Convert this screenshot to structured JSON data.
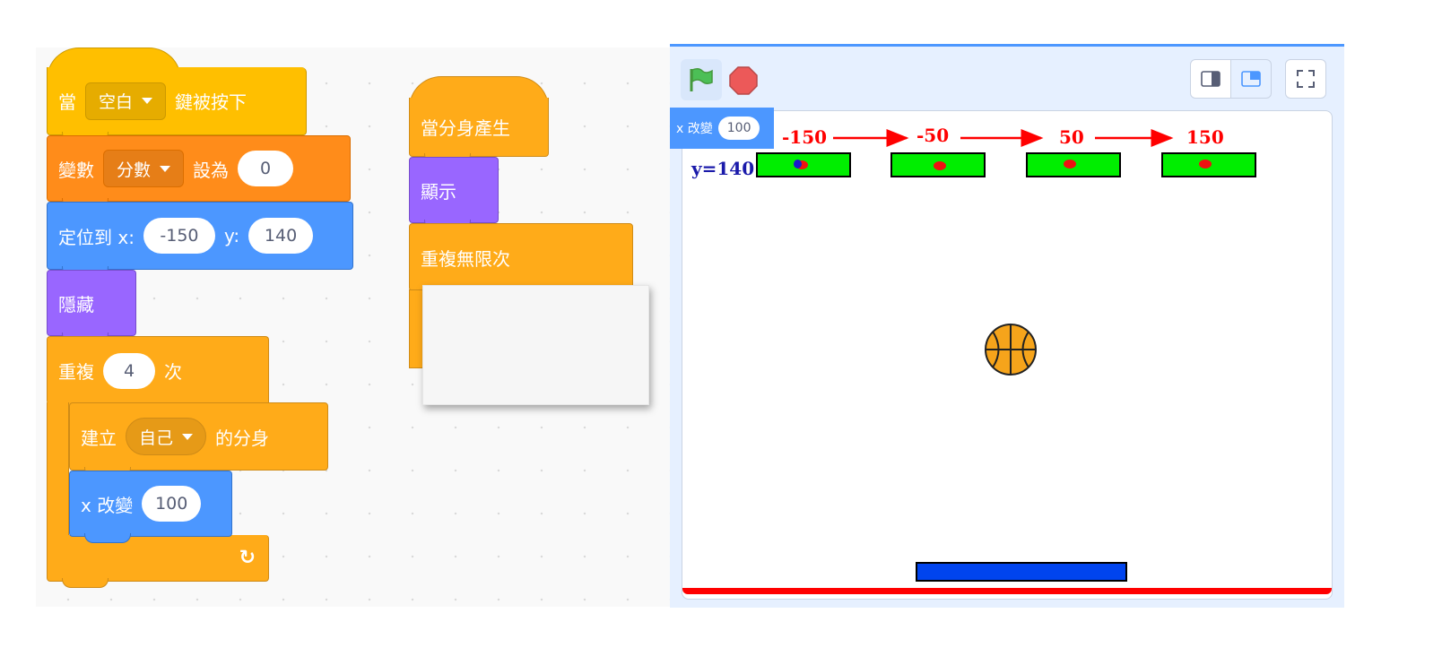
{
  "code": {
    "when_key": {
      "prefix": "當",
      "key": "空白",
      "suffix": "鍵被按下"
    },
    "set_var": {
      "prefix": "變數",
      "var": "分數",
      "mid": "設為",
      "value": "0"
    },
    "goto": {
      "prefix": "定位到 x:",
      "x": "-150",
      "ylabel": "y:",
      "y": "140"
    },
    "hide": "隱藏",
    "repeat": {
      "prefix": "重複",
      "times": "4",
      "suffix": "次"
    },
    "create_clone": {
      "prefix": "建立",
      "target": "自己",
      "suffix": "的分身"
    },
    "change_x": {
      "label": "x 改變",
      "value": "100"
    },
    "clone_hat": "當分身產生",
    "show": "顯示",
    "forever": "重複無限次"
  },
  "stage": {
    "monitor_label": "x 改變",
    "monitor_value": "100",
    "y_label": "y=140",
    "x_labels": [
      "-150",
      "-50",
      "50",
      "150"
    ],
    "colors": {
      "label_red": "#ff0000",
      "label_blue": "#1a1aaa",
      "paddle": "#0044ee",
      "floor": "#ff0000",
      "brick": "#00ee00",
      "ball": "#f6a41b"
    }
  }
}
